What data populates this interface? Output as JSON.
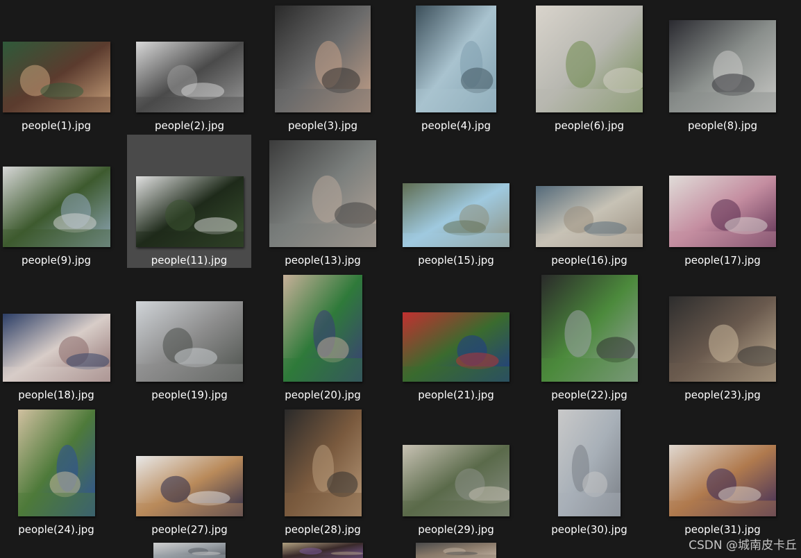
{
  "watermark": "CSDN @城南皮卡丘",
  "items": [
    {
      "label": "people(1).jpg",
      "tone": [
        "#5b3b2e",
        "#c9a27c",
        "#2f5a3a"
      ]
    },
    {
      "label": "people(2).jpg",
      "tone": [
        "#4a4a4a",
        "#9a9a9a",
        "#d8d8d8"
      ]
    },
    {
      "label": "people(3).jpg",
      "tone": [
        "#6b6b6b",
        "#c4a088",
        "#2a2a2a"
      ]
    },
    {
      "label": "people(4).jpg",
      "tone": [
        "#a9c3cf",
        "#7f9fae",
        "#3c4f5a"
      ]
    },
    {
      "label": "people(6).jpg",
      "tone": [
        "#b7b7b0",
        "#6f8a4e",
        "#d9d4cc"
      ]
    },
    {
      "label": "people(8).jpg",
      "tone": [
        "#8a8f8c",
        "#c9c9c6",
        "#2a2a30"
      ]
    },
    {
      "label": "people(9).jpg",
      "tone": [
        "#3d5a2e",
        "#8fa6b8",
        "#d7d7d7"
      ]
    },
    {
      "label": "people(11).jpg",
      "tone": [
        "#1e2a1a",
        "#3b5230",
        "#e0e0e0"
      ]
    },
    {
      "label": "people(13).jpg",
      "tone": [
        "#7b7f7d",
        "#b8a79a",
        "#3b3b3b"
      ]
    },
    {
      "label": "people(15).jpg",
      "tone": [
        "#9fc9df",
        "#8d8f7d",
        "#5f6d52"
      ]
    },
    {
      "label": "people(16).jpg",
      "tone": [
        "#c7c2b5",
        "#9a8f80",
        "#546a7a"
      ]
    },
    {
      "label": "people(17).jpg",
      "tone": [
        "#c48da0",
        "#5a2d50",
        "#e0dcd8"
      ]
    },
    {
      "label": "people(18).jpg",
      "tone": [
        "#d8cdc8",
        "#8a6a6a",
        "#2c3e66"
      ]
    },
    {
      "label": "people(19).jpg",
      "tone": [
        "#8c8c8c",
        "#4a4f4a",
        "#d0d4d8"
      ]
    },
    {
      "label": "people(20).jpg",
      "tone": [
        "#2f7a3a",
        "#3b3b7a",
        "#c7b099"
      ]
    },
    {
      "label": "people(21).jpg",
      "tone": [
        "#3a6b2e",
        "#1f3a8a",
        "#c23030"
      ]
    },
    {
      "label": "people(22).jpg",
      "tone": [
        "#4c8a3c",
        "#9da3a8",
        "#2a2a2a"
      ]
    },
    {
      "label": "people(23).jpg",
      "tone": [
        "#6a5a4e",
        "#c9b79a",
        "#2d2d2d"
      ]
    },
    {
      "label": "people(24).jpg",
      "tone": [
        "#4e7a3a",
        "#2d4f9a",
        "#d0c0a0"
      ]
    },
    {
      "label": "people(27).jpg",
      "tone": [
        "#b98a5a",
        "#2a2a4a",
        "#e8e8e8"
      ]
    },
    {
      "label": "people(28).jpg",
      "tone": [
        "#7a5a3e",
        "#b89a7a",
        "#2a2a2a"
      ]
    },
    {
      "label": "people(29).jpg",
      "tone": [
        "#5a6a4a",
        "#8a8f86",
        "#c8c2b4"
      ]
    },
    {
      "label": "people(30).jpg",
      "tone": [
        "#a8b0b8",
        "#7a7f86",
        "#c9c9c9"
      ]
    },
    {
      "label": "people(31).jpg",
      "tone": [
        "#b07a4e",
        "#3b2a5a",
        "#e0d8d0"
      ]
    },
    {
      "label": "",
      "tone": [
        "#9aa0a6",
        "#5a5f66",
        "#d0d0d0"
      ]
    },
    {
      "label": "",
      "tone": [
        "#3a2a2a",
        "#7a5a9a",
        "#b0a080"
      ]
    },
    {
      "label": "",
      "tone": [
        "#8a7a6a",
        "#c0b0a0",
        "#4a4a4a"
      ]
    }
  ]
}
